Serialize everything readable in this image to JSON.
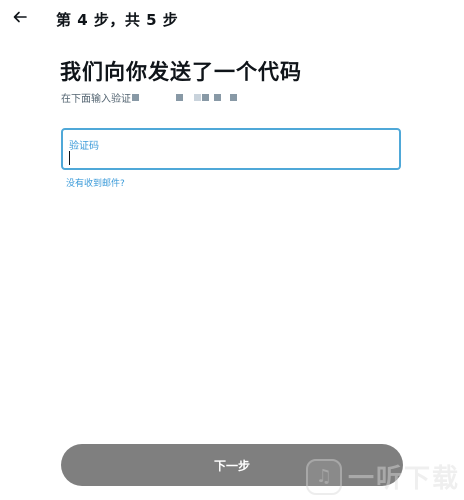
{
  "header": {
    "back_icon": "arrow-left-icon",
    "step_title": "第 4 步，共 5 步"
  },
  "main": {
    "heading": "我们向你发送了一个代码",
    "subtext": "在下面输入验证",
    "code_field": {
      "label": "验证码",
      "value": ""
    },
    "no_email_link": "没有收到邮件?"
  },
  "footer": {
    "next_button_label": "下一步",
    "next_button_color": "#7f7f7f"
  },
  "watermark": {
    "text": "一听下载",
    "icon": "music-note-icon"
  },
  "colors": {
    "accent": "#4fa8d8",
    "link": "#3a9ad9",
    "text": "#0f1419",
    "muted": "#536471"
  }
}
